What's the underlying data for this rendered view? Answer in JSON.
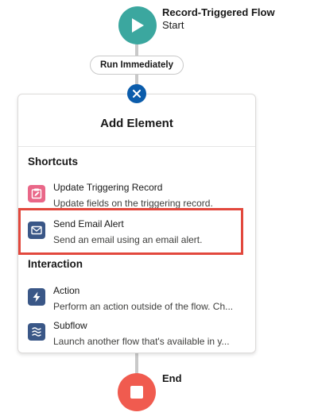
{
  "start": {
    "title": "Record-Triggered Flow",
    "subtitle": "Start",
    "color": "#3ba79f"
  },
  "schedule_pill": {
    "label": "Run Immediately"
  },
  "panel": {
    "title": "Add Element",
    "sections": [
      {
        "title": "Shortcuts",
        "items": [
          {
            "title": "Update Triggering Record",
            "description": "Update fields on the triggering record.",
            "icon": "edit-record-icon",
            "color": "#e96788"
          },
          {
            "title": "Send Email Alert",
            "description": "Send an email using an email alert.",
            "icon": "email-icon",
            "color": "#3a5787",
            "highlighted": true
          }
        ]
      },
      {
        "title": "Interaction",
        "items": [
          {
            "title": "Action",
            "description": "Perform an action outside of the flow. Ch...",
            "icon": "lightning-icon",
            "color": "#3a5787"
          },
          {
            "title": "Subflow",
            "description": "Launch another flow that's available in y...",
            "icon": "subflow-icon",
            "color": "#3a5787"
          }
        ]
      }
    ]
  },
  "end": {
    "label": "End",
    "color": "#f05b4f"
  },
  "colors": {
    "accent": "#0b5cab",
    "highlight": "#e2483d",
    "connector": "#c9c9c9"
  }
}
